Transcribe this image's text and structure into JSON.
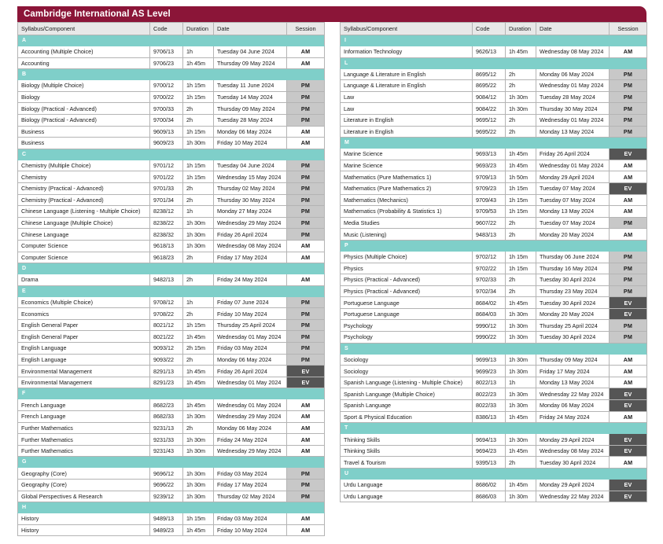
{
  "header": {
    "title": "Cambridge International AS Level",
    "bar_color": "#8b1538"
  },
  "colors": {
    "group_band": "#7fcfc9",
    "session_am": "#ffffff",
    "session_pm": "#c8c8c8",
    "session_ev": "#555555",
    "header_row": "#e8e8e8",
    "border": "#b4b4b4"
  },
  "columns": {
    "syllabus": "Syllabus/Component",
    "code": "Code",
    "duration": "Duration",
    "date": "Date",
    "session": "Session"
  },
  "left_table": [
    {
      "group": "A"
    },
    {
      "syllabus": "Accounting (Multiple Choice)",
      "code": "9706/13",
      "duration": "1h",
      "date": "Tuesday 04 June 2024",
      "session": "AM"
    },
    {
      "syllabus": "Accounting",
      "code": "9706/23",
      "duration": "1h 45m",
      "date": "Thursday 09 May 2024",
      "session": "AM"
    },
    {
      "group": "B"
    },
    {
      "syllabus": "Biology (Multiple Choice)",
      "code": "9700/12",
      "duration": "1h 15m",
      "date": "Tuesday 11 June 2024",
      "session": "PM"
    },
    {
      "syllabus": "Biology",
      "code": "9700/22",
      "duration": "1h 15m",
      "date": "Tuesday 14 May 2024",
      "session": "PM"
    },
    {
      "syllabus": "Biology (Practical - Advanced)",
      "code": "9700/33",
      "duration": "2h",
      "date": "Thursday 09 May 2024",
      "session": "PM"
    },
    {
      "syllabus": "Biology (Practical - Advanced)",
      "code": "9700/34",
      "duration": "2h",
      "date": "Tuesday 28 May 2024",
      "session": "PM"
    },
    {
      "syllabus": "Business",
      "code": "9609/13",
      "duration": "1h 15m",
      "date": "Monday 06 May 2024",
      "session": "AM"
    },
    {
      "syllabus": "Business",
      "code": "9609/23",
      "duration": "1h 30m",
      "date": "Friday 10 May 2024",
      "session": "AM"
    },
    {
      "group": "C"
    },
    {
      "syllabus": "Chemistry (Multiple Choice)",
      "code": "9701/12",
      "duration": "1h 15m",
      "date": "Tuesday 04 June 2024",
      "session": "PM"
    },
    {
      "syllabus": "Chemistry",
      "code": "9701/22",
      "duration": "1h 15m",
      "date": "Wednesday 15 May 2024",
      "session": "PM"
    },
    {
      "syllabus": "Chemistry (Practical - Advanced)",
      "code": "9701/33",
      "duration": "2h",
      "date": "Thursday 02 May 2024",
      "session": "PM"
    },
    {
      "syllabus": "Chemistry (Practical - Advanced)",
      "code": "9701/34",
      "duration": "2h",
      "date": "Thursday 30 May 2024",
      "session": "PM"
    },
    {
      "syllabus": "Chinese Language (Listening - Multiple Choice)",
      "code": "8238/12",
      "duration": "1h",
      "date": "Monday 27 May 2024",
      "session": "PM"
    },
    {
      "syllabus": "Chinese Language (Multiple Choice)",
      "code": "8238/22",
      "duration": "1h 30m",
      "date": "Wednesday 29 May 2024",
      "session": "PM"
    },
    {
      "syllabus": "Chinese Language",
      "code": "8238/32",
      "duration": "1h 30m",
      "date": "Friday 26 April 2024",
      "session": "PM"
    },
    {
      "syllabus": "Computer Science",
      "code": "9618/13",
      "duration": "1h 30m",
      "date": "Wednesday 08 May 2024",
      "session": "AM"
    },
    {
      "syllabus": "Computer Science",
      "code": "9618/23",
      "duration": "2h",
      "date": "Friday 17 May 2024",
      "session": "AM"
    },
    {
      "group": "D"
    },
    {
      "syllabus": "Drama",
      "code": "9482/13",
      "duration": "2h",
      "date": "Friday 24 May 2024",
      "session": "AM"
    },
    {
      "group": "E"
    },
    {
      "syllabus": "Economics (Multiple Choice)",
      "code": "9708/12",
      "duration": "1h",
      "date": "Friday 07 June 2024",
      "session": "PM"
    },
    {
      "syllabus": "Economics",
      "code": "9708/22",
      "duration": "2h",
      "date": "Friday 10 May 2024",
      "session": "PM"
    },
    {
      "syllabus": "English General Paper",
      "code": "8021/12",
      "duration": "1h 15m",
      "date": "Thursday 25 April 2024",
      "session": "PM"
    },
    {
      "syllabus": "English General Paper",
      "code": "8021/22",
      "duration": "1h 45m",
      "date": "Wednesday 01 May 2024",
      "session": "PM"
    },
    {
      "syllabus": "English Language",
      "code": "9093/12",
      "duration": "2h 15m",
      "date": "Friday 03 May 2024",
      "session": "PM"
    },
    {
      "syllabus": "English Language",
      "code": "9093/22",
      "duration": "2h",
      "date": "Monday 06 May 2024",
      "session": "PM"
    },
    {
      "syllabus": "Environmental Management",
      "code": "8291/13",
      "duration": "1h 45m",
      "date": "Friday 26 April 2024",
      "session": "EV"
    },
    {
      "syllabus": "Environmental Management",
      "code": "8291/23",
      "duration": "1h 45m",
      "date": "Wednesday 01 May 2024",
      "session": "EV"
    },
    {
      "group": "F"
    },
    {
      "syllabus": "French Language",
      "code": "8682/23",
      "duration": "1h 45m",
      "date": "Wednesday 01 May 2024",
      "session": "AM"
    },
    {
      "syllabus": "French Language",
      "code": "8682/33",
      "duration": "1h 30m",
      "date": "Wednesday 29 May 2024",
      "session": "AM"
    },
    {
      "syllabus": "Further Mathematics",
      "code": "9231/13",
      "duration": "2h",
      "date": "Monday 06 May 2024",
      "session": "AM"
    },
    {
      "syllabus": "Further Mathematics",
      "code": "9231/33",
      "duration": "1h 30m",
      "date": "Friday 24 May 2024",
      "session": "AM"
    },
    {
      "syllabus": "Further Mathematics",
      "code": "9231/43",
      "duration": "1h 30m",
      "date": "Wednesday 29 May 2024",
      "session": "AM"
    },
    {
      "group": "G"
    },
    {
      "syllabus": "Geography (Core)",
      "code": "9696/12",
      "duration": "1h 30m",
      "date": "Friday 03 May 2024",
      "session": "PM"
    },
    {
      "syllabus": "Geography (Core)",
      "code": "9696/22",
      "duration": "1h 30m",
      "date": "Friday 17 May 2024",
      "session": "PM"
    },
    {
      "syllabus": "Global Perspectives & Research",
      "code": "9239/12",
      "duration": "1h 30m",
      "date": "Thursday 02 May 2024",
      "session": "PM"
    },
    {
      "group": "H"
    },
    {
      "syllabus": "History",
      "code": "9489/13",
      "duration": "1h 15m",
      "date": "Friday 03 May 2024",
      "session": "AM"
    },
    {
      "syllabus": "History",
      "code": "9489/23",
      "duration": "1h 45m",
      "date": "Friday 10 May 2024",
      "session": "AM"
    }
  ],
  "right_table": [
    {
      "group": "I"
    },
    {
      "syllabus": "Information Technology",
      "code": "9626/13",
      "duration": "1h 45m",
      "date": "Wednesday 08 May 2024",
      "session": "AM"
    },
    {
      "group": "L"
    },
    {
      "syllabus": "Language & Literature in English",
      "code": "8695/12",
      "duration": "2h",
      "date": "Monday 06 May 2024",
      "session": "PM"
    },
    {
      "syllabus": "Language & Literature in English",
      "code": "8695/22",
      "duration": "2h",
      "date": "Wednesday 01 May 2024",
      "session": "PM"
    },
    {
      "syllabus": "Law",
      "code": "9084/12",
      "duration": "1h 30m",
      "date": "Tuesday 28 May 2024",
      "session": "PM"
    },
    {
      "syllabus": "Law",
      "code": "9084/22",
      "duration": "1h 30m",
      "date": "Thursday 30 May 2024",
      "session": "PM"
    },
    {
      "syllabus": "Literature in English",
      "code": "9695/12",
      "duration": "2h",
      "date": "Wednesday 01 May 2024",
      "session": "PM"
    },
    {
      "syllabus": "Literature in English",
      "code": "9695/22",
      "duration": "2h",
      "date": "Monday 13 May 2024",
      "session": "PM"
    },
    {
      "group": "M"
    },
    {
      "syllabus": "Marine Science",
      "code": "9693/13",
      "duration": "1h 45m",
      "date": "Friday 26 April 2024",
      "session": "EV"
    },
    {
      "syllabus": "Marine Science",
      "code": "9693/23",
      "duration": "1h 45m",
      "date": "Wednesday 01 May 2024",
      "session": "AM"
    },
    {
      "syllabus": "Mathematics (Pure Mathematics 1)",
      "code": "9709/13",
      "duration": "1h 50m",
      "date": "Monday 29 April 2024",
      "session": "AM"
    },
    {
      "syllabus": "Mathematics (Pure Mathematics 2)",
      "code": "9709/23",
      "duration": "1h 15m",
      "date": "Tuesday 07 May 2024",
      "session": "EV"
    },
    {
      "syllabus": "Mathematics (Mechanics)",
      "code": "9709/43",
      "duration": "1h 15m",
      "date": "Tuesday 07 May 2024",
      "session": "AM"
    },
    {
      "syllabus": "Mathematics (Probability & Statistics 1)",
      "code": "9709/53",
      "duration": "1h 15m",
      "date": "Monday 13 May 2024",
      "session": "AM"
    },
    {
      "syllabus": "Media Studies",
      "code": "9607/22",
      "duration": "2h",
      "date": "Tuesday 07 May 2024",
      "session": "PM"
    },
    {
      "syllabus": "Music (Listening)",
      "code": "9483/13",
      "duration": "2h",
      "date": "Monday 20 May 2024",
      "session": "AM"
    },
    {
      "group": "P"
    },
    {
      "syllabus": "Physics (Multiple Choice)",
      "code": "9702/12",
      "duration": "1h 15m",
      "date": "Thursday 06 June 2024",
      "session": "PM"
    },
    {
      "syllabus": "Physics",
      "code": "9702/22",
      "duration": "1h 15m",
      "date": "Thursday 16 May 2024",
      "session": "PM"
    },
    {
      "syllabus": "Physics (Practical - Advanced)",
      "code": "9702/33",
      "duration": "2h",
      "date": "Tuesday 30 April 2024",
      "session": "PM"
    },
    {
      "syllabus": "Physics (Practical - Advanced)",
      "code": "9702/34",
      "duration": "2h",
      "date": "Thursday 23 May 2024",
      "session": "PM"
    },
    {
      "syllabus": "Portuguese Language",
      "code": "8684/02",
      "duration": "1h 45m",
      "date": "Tuesday 30 April 2024",
      "session": "EV"
    },
    {
      "syllabus": "Portuguese Language",
      "code": "8684/03",
      "duration": "1h 30m",
      "date": "Monday 20 May 2024",
      "session": "EV"
    },
    {
      "syllabus": "Psychology",
      "code": "9990/12",
      "duration": "1h 30m",
      "date": "Thursday 25 April 2024",
      "session": "PM"
    },
    {
      "syllabus": "Psychology",
      "code": "9990/22",
      "duration": "1h 30m",
      "date": "Tuesday 30 April 2024",
      "session": "PM"
    },
    {
      "group": "S"
    },
    {
      "syllabus": "Sociology",
      "code": "9699/13",
      "duration": "1h 30m",
      "date": "Thursday 09 May 2024",
      "session": "AM"
    },
    {
      "syllabus": "Sociology",
      "code": "9699/23",
      "duration": "1h 30m",
      "date": "Friday 17 May 2024",
      "session": "AM"
    },
    {
      "syllabus": "Spanish Language (Listening - Multiple Choice)",
      "code": "8022/13",
      "duration": "1h",
      "date": "Monday 13 May 2024",
      "session": "AM"
    },
    {
      "syllabus": "Spanish Language (Multiple Choice)",
      "code": "8022/23",
      "duration": "1h 30m",
      "date": "Wednesday 22 May 2024",
      "session": "EV"
    },
    {
      "syllabus": "Spanish Language",
      "code": "8022/33",
      "duration": "1h 30m",
      "date": "Monday 06 May 2024",
      "session": "EV"
    },
    {
      "syllabus": "Sport & Physical Education",
      "code": "8386/13",
      "duration": "1h 45m",
      "date": "Friday 24 May 2024",
      "session": "AM"
    },
    {
      "group": "T"
    },
    {
      "syllabus": "Thinking Skills",
      "code": "9694/13",
      "duration": "1h 30m",
      "date": "Monday 29 April 2024",
      "session": "EV"
    },
    {
      "syllabus": "Thinking Skills",
      "code": "9694/23",
      "duration": "1h 45m",
      "date": "Wednesday 08 May 2024",
      "session": "EV"
    },
    {
      "syllabus": "Travel & Tourism",
      "code": "9395/13",
      "duration": "2h",
      "date": "Tuesday 30 April 2024",
      "session": "AM"
    },
    {
      "group": "U"
    },
    {
      "syllabus": "Urdu Language",
      "code": "8686/02",
      "duration": "1h 45m",
      "date": "Monday 29 April 2024",
      "session": "EV"
    },
    {
      "syllabus": "Urdu Language",
      "code": "8686/03",
      "duration": "1h 30m",
      "date": "Wednesday 22 May 2024",
      "session": "EV"
    }
  ]
}
